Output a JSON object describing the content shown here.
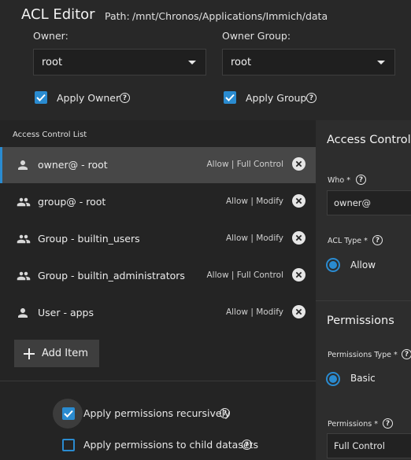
{
  "header": {
    "title": "ACL Editor",
    "path_label": "Path:",
    "path_value": "/mnt/Chronos/Applications/Immich/data"
  },
  "owner": {
    "label": "Owner:",
    "value": "root",
    "apply_label": "Apply Owner",
    "apply_checked": true
  },
  "group": {
    "label": "Owner Group:",
    "value": "root",
    "apply_label": "Apply Group",
    "apply_checked": true
  },
  "acl_list": {
    "heading": "Access Control List",
    "items": [
      {
        "icon": "person-icon",
        "name": "owner@ - root",
        "perm": "Allow | Full Control",
        "selected": true
      },
      {
        "icon": "group-icon",
        "name": "group@ - root",
        "perm": "Allow | Modify",
        "selected": false
      },
      {
        "icon": "group-icon",
        "name": "Group - builtin_users",
        "perm": "Allow | Modify",
        "selected": false
      },
      {
        "icon": "group-icon",
        "name": "Group - builtin_administrators",
        "perm": "Allow | Full Control",
        "selected": false
      },
      {
        "icon": "person-icon",
        "name": "User - apps",
        "perm": "Allow | Modify",
        "selected": false
      }
    ],
    "add_label": "Add Item"
  },
  "options": {
    "recursive_label": "Apply permissions recursively",
    "recursive_checked": true,
    "child_label": "Apply permissions to child datasets",
    "child_checked": false
  },
  "entry": {
    "heading": "Access Control",
    "who_label": "Who *",
    "who_value": "owner@",
    "type_label": "ACL Type *",
    "type_value": "Allow",
    "permissions_heading": "Permissions",
    "perm_type_label": "Permissions Type *",
    "perm_type_value": "Basic",
    "permissions_label": "Permissions *",
    "permissions_value": "Full Control"
  },
  "colors": {
    "accent": "#2a8bd0",
    "background": "#282828",
    "panel": "#242424",
    "selected_row": "#474747"
  }
}
